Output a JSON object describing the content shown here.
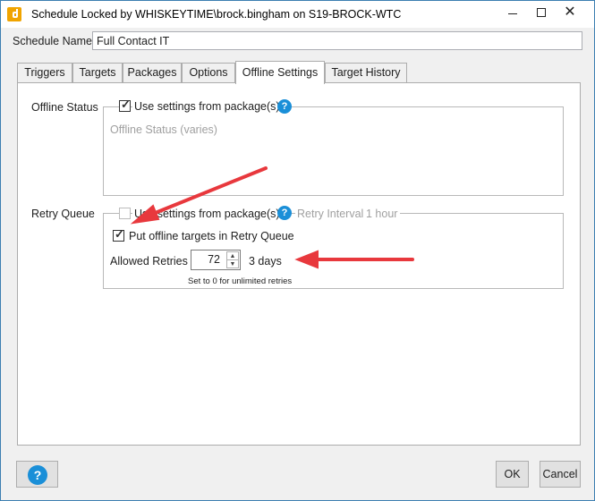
{
  "window": {
    "title": "Schedule Locked by WHISKEYTIME\\brock.bingham on S19-BROCK-WTC",
    "minimize_glyph": "",
    "close_glyph": "✕"
  },
  "schedule": {
    "name_label": "Schedule Name",
    "name_value": "Full Contact IT"
  },
  "tabs": [
    {
      "label": "Triggers",
      "active": false
    },
    {
      "label": "Targets",
      "active": false
    },
    {
      "label": "Packages",
      "active": false
    },
    {
      "label": "Options",
      "active": false
    },
    {
      "label": "Offline Settings",
      "active": true
    },
    {
      "label": "Target History",
      "active": false
    }
  ],
  "offline_status": {
    "section_label": "Offline Status",
    "use_package_settings_label": "Use settings from package(s)",
    "use_package_settings_checked": true,
    "status_text": "Offline Status (varies)",
    "help_glyph": "?"
  },
  "retry_queue": {
    "section_label": "Retry Queue",
    "use_package_settings_label": "Use settings from package(s)",
    "use_package_settings_checked": false,
    "help_glyph": "?",
    "retry_interval_label": "Retry Interval",
    "retry_interval_value": "1 hour",
    "put_offline_label": "Put offline targets in Retry Queue",
    "put_offline_checked": true,
    "allowed_retries_label": "Allowed Retries",
    "allowed_retries_value": "72",
    "duration_text": "3 days",
    "hint_text": "Set to 0 for unlimited retries"
  },
  "footer": {
    "help_glyph": "?",
    "ok_label": "OK",
    "cancel_label": "Cancel"
  },
  "colors": {
    "accent": "#1a8fd8",
    "annotation_arrow": "#e8383d",
    "app_icon": "#f0a400"
  },
  "icons": [
    "app-logo-icon",
    "minimize-icon",
    "maximize-icon",
    "close-icon",
    "help-icon",
    "checkmark-icon",
    "spinner-up-icon",
    "spinner-down-icon",
    "annotation-arrow-icon"
  ]
}
